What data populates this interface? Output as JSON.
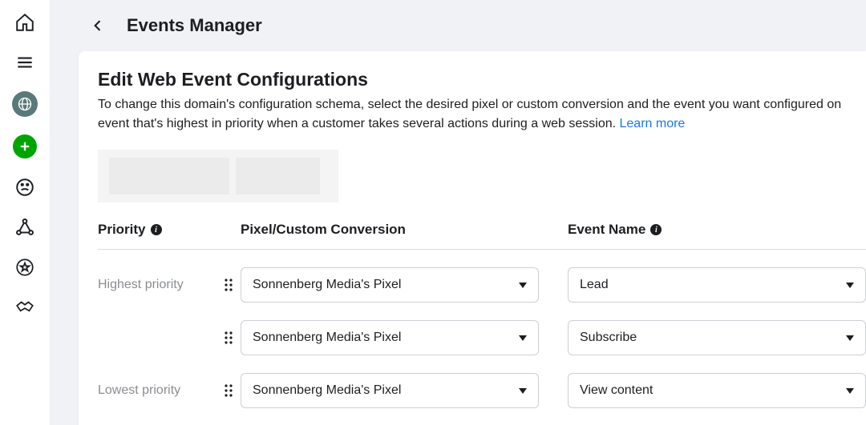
{
  "header": {
    "title": "Events Manager"
  },
  "page": {
    "title": "Edit Web Event Configurations",
    "description": "To change this domain's configuration schema, select the desired pixel or custom conversion and the event you want configured on event that's highest in priority when a customer takes several actions during a web session. ",
    "learn_more_label": "Learn more"
  },
  "columns": {
    "priority": "Priority",
    "pixel": "Pixel/Custom Conversion",
    "event": "Event Name"
  },
  "priority_labels": {
    "highest": "Highest priority",
    "lowest": "Lowest priority"
  },
  "rows": [
    {
      "priority_text": "Highest priority",
      "pixel": "Sonnenberg Media's Pixel",
      "event": "Lead"
    },
    {
      "priority_text": "",
      "pixel": "Sonnenberg Media's Pixel",
      "event": "Subscribe"
    },
    {
      "priority_text": "Lowest priority",
      "pixel": "Sonnenberg Media's Pixel",
      "event": "View content"
    }
  ]
}
